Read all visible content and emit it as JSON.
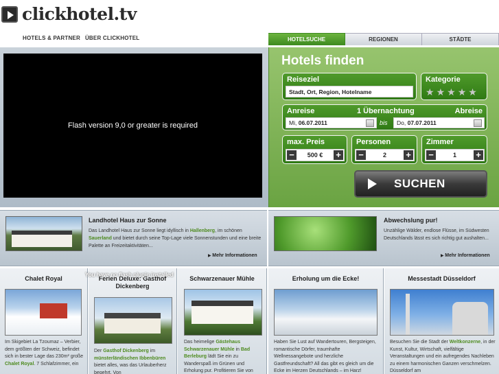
{
  "logo": {
    "text": "clickhotel.tv"
  },
  "topnav": [
    "HOTELS & PARTNER",
    "ÜBER CLICKHOTEL"
  ],
  "tabs": [
    "HOTELSUCHE",
    "REGIONEN",
    "STÄDTE"
  ],
  "video": {
    "message": "Flash version 9,0 or greater is required"
  },
  "search": {
    "title": "Hotels finden",
    "destination": {
      "label": "Reiseziel",
      "placeholder": "Stadt, Ort, Region, Hotelname"
    },
    "category": {
      "label": "Kategorie",
      "stars": 5
    },
    "arrival": {
      "label": "Anreise",
      "day": "Mi,",
      "date": "06.07.2011"
    },
    "nights": "1 Übernachtung",
    "departure": {
      "label": "Abreise",
      "day": "Do,",
      "date": "07.07.2011"
    },
    "between": "bis",
    "price": {
      "label": "max. Preis",
      "value": "500 €"
    },
    "persons": {
      "label": "Personen",
      "value": "2"
    },
    "rooms": {
      "label": "Zimmer",
      "value": "1"
    },
    "button": "SUCHEN"
  },
  "feature1": {
    "title": "Landhotel Haus zur Sonne",
    "text_a": "Das Landhotel Haus zur Sonne liegt idyllisch in ",
    "link1": "Hallenberg",
    "text_b": ", im schönen ",
    "link2": "Sauerland",
    "text_c": " und bietet durch seine Top-Lage viele Sonnenstunden und eine breite Palette an Freizeitaktivitäten...",
    "more": "Mehr Informationen"
  },
  "feature2": {
    "title": "Abwechslung pur!",
    "text": "Unzählige Wälder, endlose Flüsse, im Südwesten Deutschlands lässt es sich richtig gut aushalten...",
    "more": "Mehr Informationen"
  },
  "overlay": "You have no flash plugin installed",
  "columns": [
    {
      "title": "Chalet Royal",
      "text": "Im Skigebiet La Tzoumaz – Verbier, dem größten der Schweiz, befindet sich in bester Lage das 230m² große ",
      "link": "Chalet Royal",
      "text2": ". 7 Schlafzimmer, ein"
    },
    {
      "title": "Ferien Deluxe: Gasthof Dickenberg",
      "text": "Der ",
      "link": "Gasthof Dickenberg",
      "text2": " im ",
      "link2": "münsterländischen Ibbenbüren",
      "text3": " bietet alles, was das Urlauberherz begehrt. Von"
    },
    {
      "title": "Schwarzenauer Mühle",
      "text": "Das heimelige ",
      "link": "Gästehaus Schwarzenauer Mühle",
      "text2": " in ",
      "link2": "Bad Berleburg",
      "text3": " lädt Sie ein zu Wanderspaß im Grünen und Erholung pur. Profitieren Sie von"
    },
    {
      "title": "Erholung um die Ecke!",
      "text": "Haben Sie Lust auf Wandertouren, Bergsteigen, romantische Dörfer, traumhafte Wellnessangebote und herzliche Gastfreundschaft? All das gibt es gleich um die Ecke im Herzen Deutschlands – im Harz!"
    },
    {
      "title": "Messestadt Düsseldorf",
      "text": "Besuchen Sie die Stadt der ",
      "link": "Weltkonzerne",
      "text2": ", in der Kunst, Kultur, Wirtschaft, vielfältige Veranstaltungen und ein aufregendes Nachleben zu einem harmonischen Ganzen verschmelzen. Düsseldorf am"
    }
  ],
  "colors": {
    "green": "#4f9a2b",
    "band": "#b9c4ce",
    "link": "#4d8a1e"
  }
}
